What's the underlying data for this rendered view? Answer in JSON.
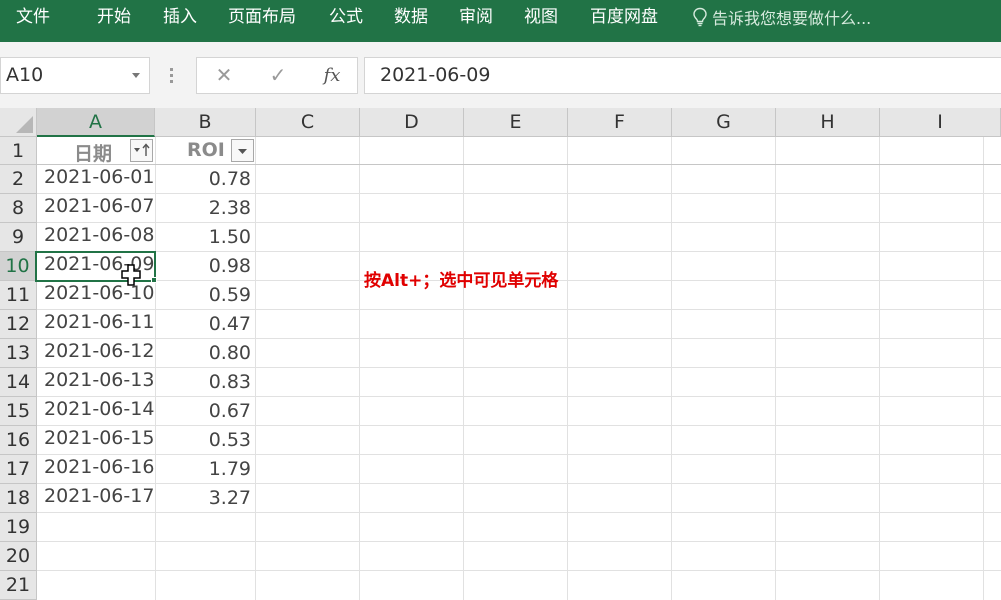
{
  "ribbon": {
    "tabs": [
      "文件",
      "开始",
      "插入",
      "页面布局",
      "公式",
      "数据",
      "审阅",
      "视图",
      "百度网盘"
    ],
    "tell_me": "告诉我您想要做什么..."
  },
  "formula_bar": {
    "name_box": "A10",
    "cancel_symbol": "✕",
    "enter_symbol": "✓",
    "fx_label": "fx",
    "formula_value": "2021-06-09"
  },
  "sheet": {
    "columns": [
      "A",
      "B",
      "C",
      "D",
      "E",
      "F",
      "G",
      "H",
      "I"
    ],
    "selected_column": "A",
    "row_numbers": [
      "1",
      "2",
      "8",
      "9",
      "10",
      "11",
      "12",
      "13",
      "14",
      "15",
      "16",
      "17",
      "18",
      "19",
      "20",
      "21"
    ],
    "selected_row": "10",
    "header": {
      "date": "日期",
      "roi": "ROI"
    },
    "rows": [
      {
        "date": "2021-06-01",
        "roi": "0.78"
      },
      {
        "date": "2021-06-07",
        "roi": "2.38"
      },
      {
        "date": "2021-06-08",
        "roi": "1.50"
      },
      {
        "date": "2021-06-09",
        "roi": "0.98"
      },
      {
        "date": "2021-06-10",
        "roi": "0.59"
      },
      {
        "date": "2021-06-11",
        "roi": "0.47"
      },
      {
        "date": "2021-06-12",
        "roi": "0.80"
      },
      {
        "date": "2021-06-13",
        "roi": "0.83"
      },
      {
        "date": "2021-06-14",
        "roi": "0.67"
      },
      {
        "date": "2021-06-15",
        "roi": "0.53"
      },
      {
        "date": "2021-06-16",
        "roi": "1.79"
      },
      {
        "date": "2021-06-17",
        "roi": "3.27"
      }
    ],
    "annotation": "按Alt+；选中可见单元格",
    "annotation_color": "#e00000"
  },
  "colors": {
    "accent": "#217346"
  },
  "icons": {
    "lightbulb": "lightbulb-icon",
    "filter_sort": "sort-ascending-filter-icon",
    "filter": "filter-dropdown-icon",
    "cursor": "cross-cursor-icon"
  }
}
